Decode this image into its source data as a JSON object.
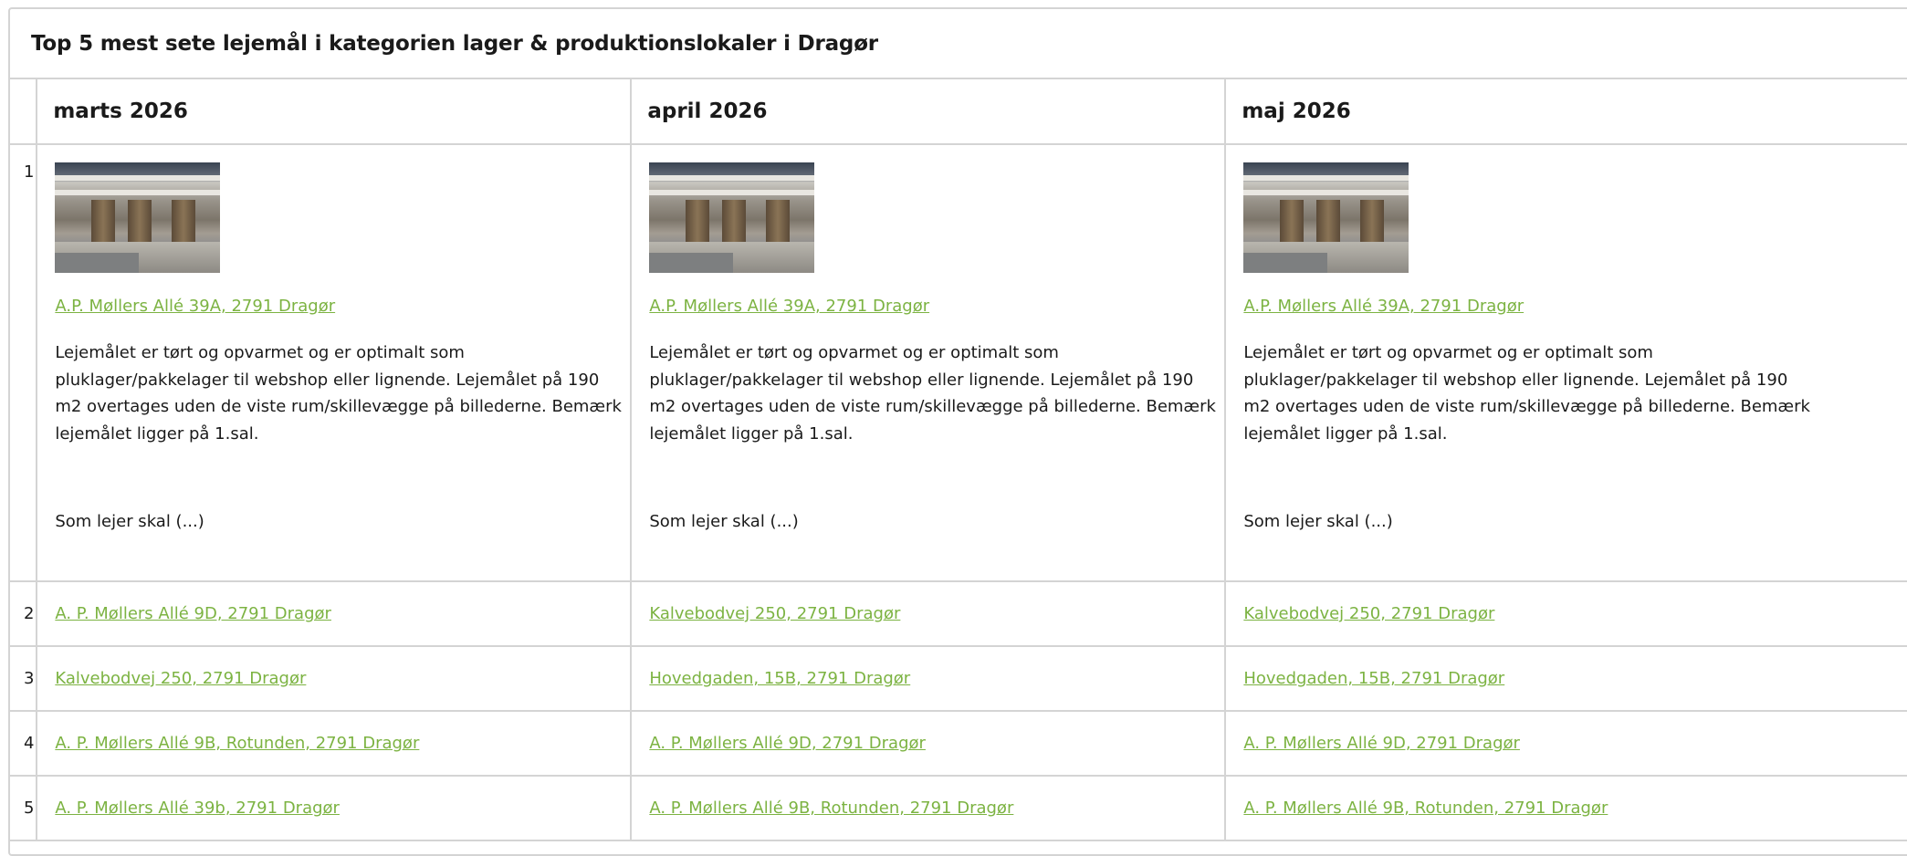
{
  "title": "Top 5 mest sete lejemål i kategorien lager & produktionslokaler i Dragør",
  "columns": [
    "marts 2026",
    "april 2026",
    "maj 2026"
  ],
  "rank_numbers": [
    "1",
    "2",
    "3",
    "4",
    "5"
  ],
  "top_listing": {
    "image_icon": "warehouse-photo",
    "address": "A.P. Møllers Allé 39A, 2791 Dragør",
    "description": "Lejemålet er tørt og opvarmet og er optimalt som pluklager/pakkelager til webshop eller lignende. Lejemålet på 190 m2 overtages uden de viste rum/skillevægge på billederne. Bemærk lejemålet ligger på 1.sal.",
    "more": "Som lejer skal (...)"
  },
  "rows": [
    [
      "A. P. Møllers Allé 9D, 2791 Dragør",
      "Kalvebodvej 250, 2791 Dragør",
      "Kalvebodvej 250, 2791 Dragør"
    ],
    [
      "Kalvebodvej 250, 2791 Dragør",
      "Hovedgaden, 15B, 2791 Dragør",
      "Hovedgaden, 15B, 2791 Dragør"
    ],
    [
      "A. P. Møllers Allé 9B, Rotunden, 2791 Dragør",
      "A. P. Møllers Allé 9D, 2791 Dragør",
      "A. P. Møllers Allé 9D, 2791 Dragør"
    ],
    [
      "A. P. Møllers Allé 39b, 2791 Dragør",
      "A. P. Møllers Allé 9B, Rotunden, 2791 Dragør",
      "A. P. Møllers Allé 9B, Rotunden, 2791 Dragør"
    ]
  ],
  "colors": {
    "link": "#7cb342",
    "border": "#d4d4d4"
  }
}
